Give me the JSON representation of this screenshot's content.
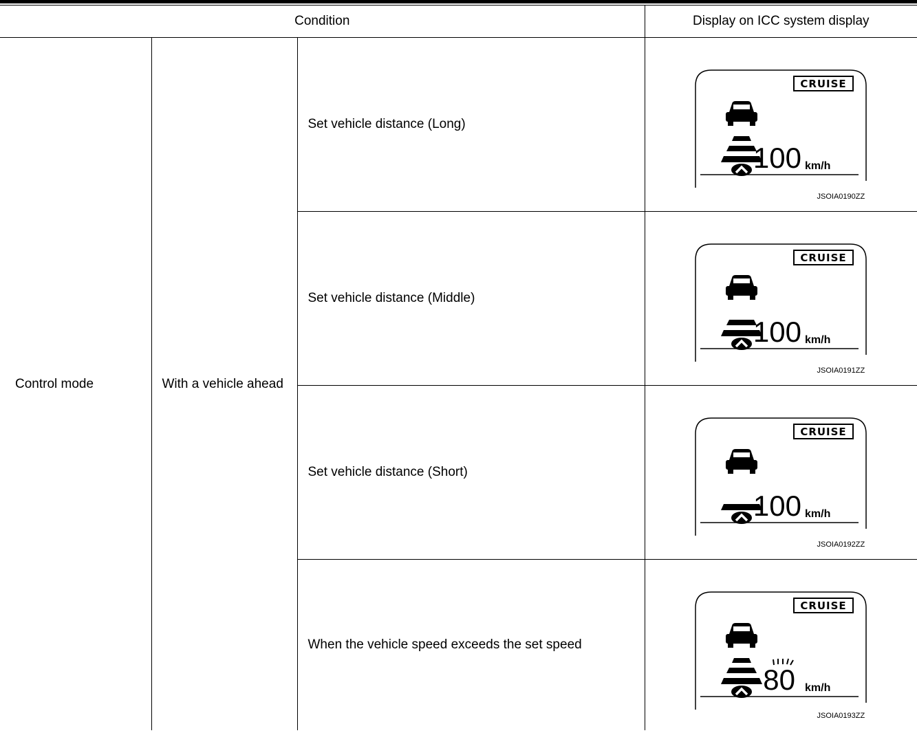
{
  "header": {
    "condition": "Condition",
    "display": "Display on ICC system display"
  },
  "mode": "Control mode",
  "situation": "With a vehicle ahead",
  "rows": [
    {
      "condition": "Set vehicle distance (Long)",
      "bars": 3,
      "speed": "100",
      "unit": "km/h",
      "badge": "CRUISE",
      "code": "JSOIA0190ZZ",
      "blinking": false
    },
    {
      "condition": "Set vehicle distance (Middle)",
      "bars": 2,
      "speed": "100",
      "unit": "km/h",
      "badge": "CRUISE",
      "code": "JSOIA0191ZZ",
      "blinking": false
    },
    {
      "condition": "Set vehicle distance (Short)",
      "bars": 1,
      "speed": "100",
      "unit": "km/h",
      "badge": "CRUISE",
      "code": "JSOIA0192ZZ",
      "blinking": false
    },
    {
      "condition": "When the vehicle speed exceeds the set speed",
      "bars": 3,
      "speed": "80",
      "unit": "km/h",
      "badge": "CRUISE",
      "code": "JSOIA0193ZZ",
      "blinking": true
    }
  ],
  "icons": [
    "car-ahead-icon",
    "distance-bar-icon",
    "own-vehicle-icon",
    "blink-rays-icon"
  ]
}
